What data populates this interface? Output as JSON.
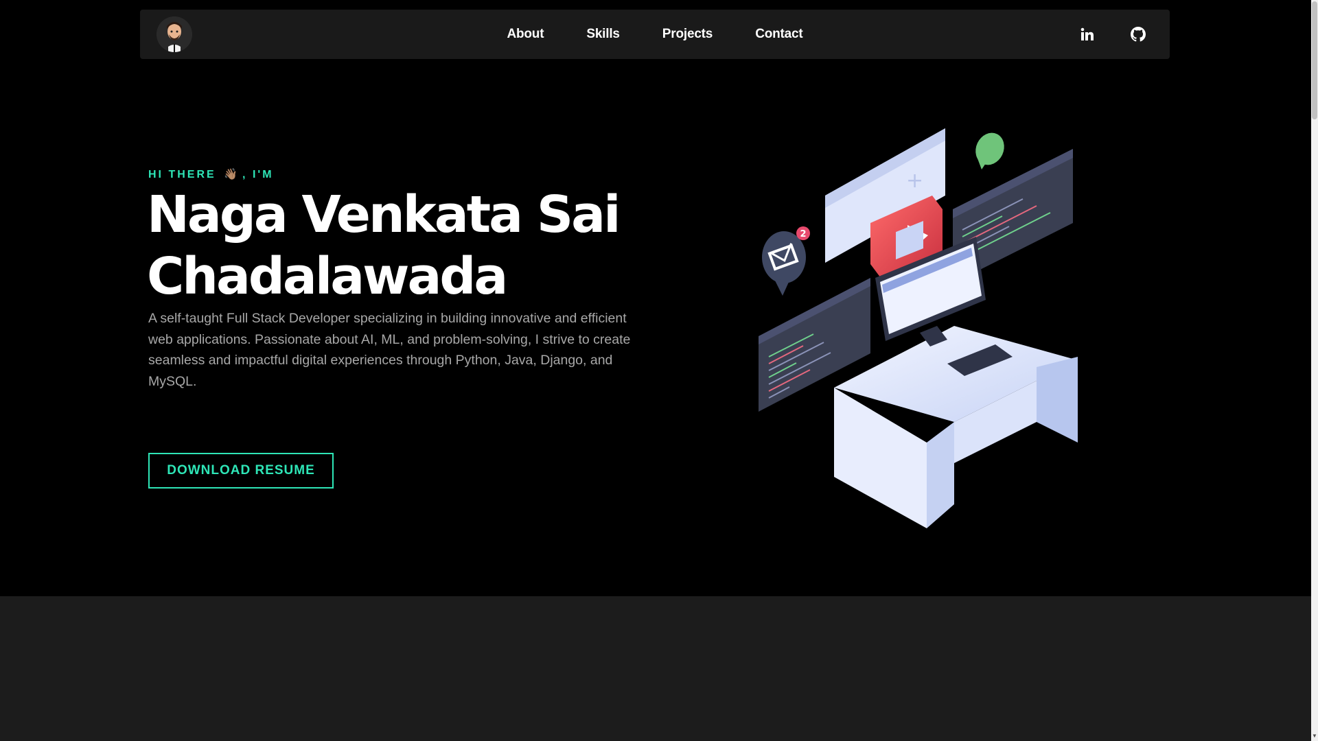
{
  "nav": {
    "links": [
      {
        "label": "About"
      },
      {
        "label": "Skills"
      },
      {
        "label": "Projects"
      },
      {
        "label": "Contact"
      }
    ],
    "social": [
      {
        "icon": "linkedin-icon"
      },
      {
        "icon": "github-icon"
      }
    ]
  },
  "hero": {
    "eyebrow_prefix": "HI THERE",
    "eyebrow_emoji": "👋🏽",
    "eyebrow_suffix": ", I'M",
    "name_line1": "Naga Venkata Sai",
    "name_line2": "Chadalawada",
    "description": "A self-taught Full Stack Developer specializing in building innovative and efficient web applications. Passionate about AI, ML, and problem-solving, I strive to create seamless and impactful digital experiences through Python, Java, Django, and MySQL.",
    "cta_label": "DOWNLOAD RESUME",
    "notification_count": "2"
  },
  "colors": {
    "accent": "#2ee6b7",
    "background": "#000000",
    "navbar": "#1a1a1a",
    "section_alt": "#1c1c1c"
  }
}
